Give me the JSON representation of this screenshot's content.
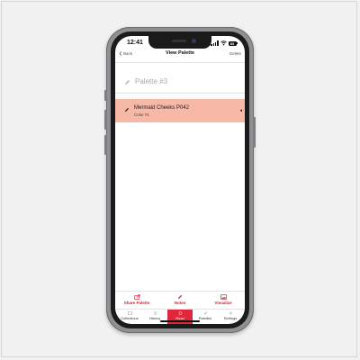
{
  "status": {
    "time": "12:41",
    "battery": "83"
  },
  "nav": {
    "back_label": "Back",
    "title": "View Palette",
    "delete_label": "Delete"
  },
  "palette": {
    "name": "Palette #3"
  },
  "colors": [
    {
      "name": "Mermaid Cheeks P042",
      "subtitle": "Color #1",
      "swatch": "#f7b8a6"
    }
  ],
  "toolbar": [
    {
      "label": "Share Palette",
      "icon": "share-icon"
    },
    {
      "label": "Notes",
      "icon": "pencil-icon"
    },
    {
      "label": "Visualize",
      "icon": "image-icon"
    }
  ],
  "tabs": [
    {
      "label": "Collections",
      "icon": "collections-icon"
    },
    {
      "label": "History",
      "icon": "history-icon"
    },
    {
      "label": "Read",
      "icon": "read-icon",
      "active": true
    },
    {
      "label": "Palettes",
      "icon": "palettes-icon"
    },
    {
      "label": "Settings",
      "icon": "settings-icon"
    }
  ],
  "colors_theme": {
    "accent": "#e0263a",
    "row": "#f7b8a6"
  }
}
